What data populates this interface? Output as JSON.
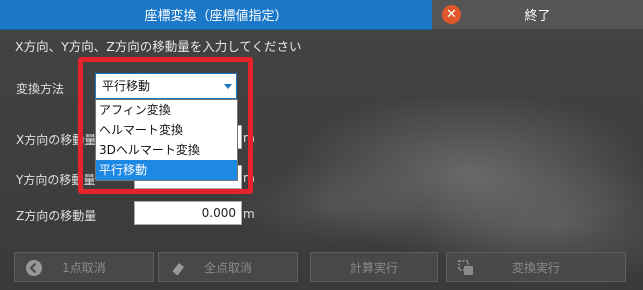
{
  "title": "座標変換（座標値指定）",
  "close_label": "終了",
  "instruction": "X方向、Y方向、Z方向の移動量を入力してください",
  "method": {
    "label": "変換方法",
    "selected": "平行移動",
    "options": [
      "アフィン変換",
      "ヘルマート変換",
      "3Dヘルマート変換",
      "平行移動"
    ]
  },
  "fields": {
    "x": {
      "label": "X方向の移動量",
      "unit": "m"
    },
    "y": {
      "label": "Y方向の移動量",
      "unit": "m"
    },
    "z": {
      "label": "Z方向の移動量",
      "value": "0.000",
      "unit": "m"
    }
  },
  "buttons": {
    "cancel_one": "1点取消",
    "cancel_all": "全点取消",
    "calculate": "計算実行",
    "execute": "変換実行"
  },
  "colors": {
    "accent": "#1b78c8",
    "highlight": "#e5232b",
    "close_icon": "#e0562a"
  }
}
